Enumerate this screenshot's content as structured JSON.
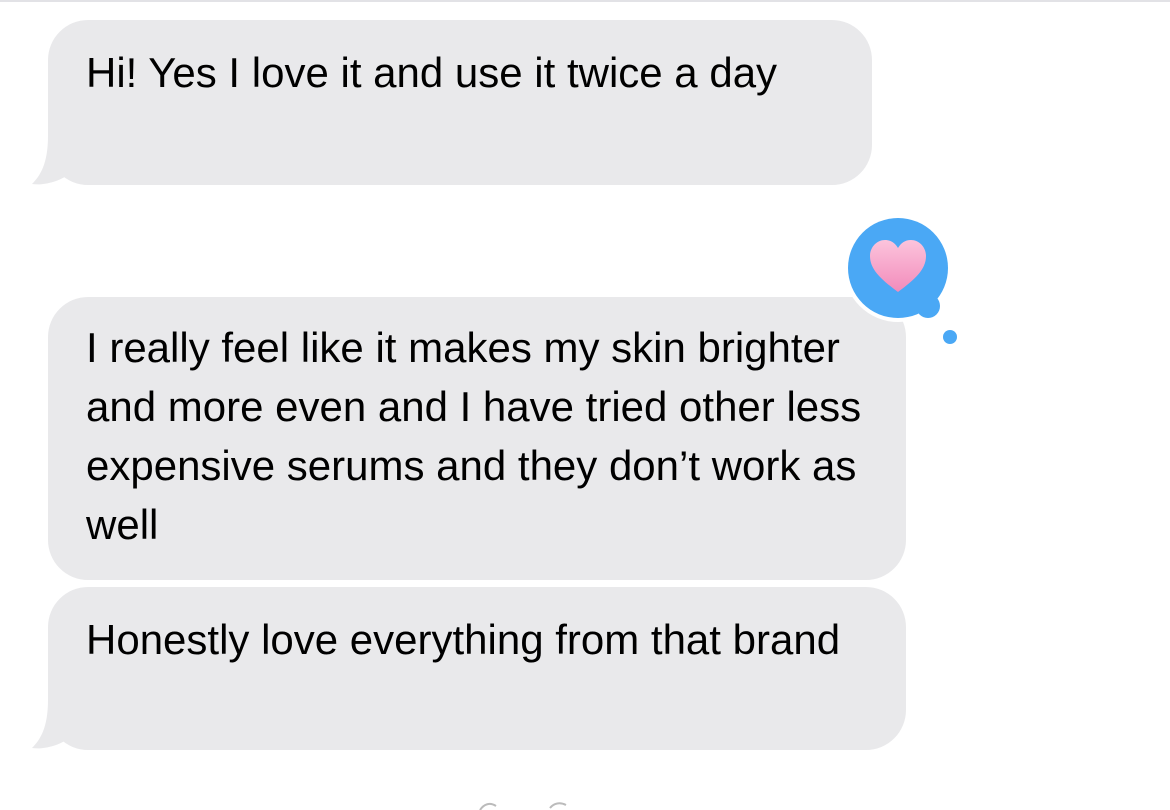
{
  "conversation": {
    "messages": [
      {
        "sender": "other",
        "text": "Hi! Yes I love it and use it twice a day"
      },
      {
        "sender": "other",
        "text": "I really feel like it makes my skin brighter and more even and I have tried other less expensive serums and they don’t work as well",
        "reaction": "heart-icon"
      },
      {
        "sender": "other",
        "text": "Honestly love everything from that brand"
      }
    ]
  },
  "colors": {
    "received_bubble": "#e9e9eb",
    "tapback_bubble": "#4aa8f5",
    "heart": "#f7a3c6"
  }
}
